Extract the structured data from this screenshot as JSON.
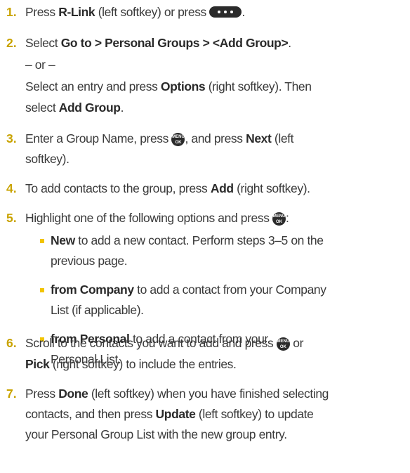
{
  "steps": [
    {
      "num": "1.",
      "parts": [
        {
          "t": "Press "
        },
        {
          "b": "R-Link"
        },
        {
          "t": " (left softkey) or press "
        },
        {
          "icon": "softkey-dots-icon"
        },
        {
          "t": "."
        }
      ]
    },
    {
      "num": "2.",
      "lines": [
        [
          {
            "t": "Select "
          },
          {
            "b": "Go to > Personal Groups > <Add Group>"
          },
          {
            "t": "."
          }
        ],
        [
          {
            "t": "– or –"
          }
        ],
        [
          {
            "t": "Select an entry and press "
          },
          {
            "b": "Options"
          },
          {
            "t": " (right softkey). Then"
          }
        ],
        [
          {
            "t": "select "
          },
          {
            "b": "Add Group"
          },
          {
            "t": "."
          }
        ]
      ]
    },
    {
      "num": "3.",
      "lines": [
        [
          {
            "t": "Enter a Group Name, press "
          },
          {
            "icon": "menu-ok-icon"
          },
          {
            "t": ", and press "
          },
          {
            "b": "Next"
          },
          {
            "t": " (left"
          }
        ],
        [
          {
            "t": "softkey)."
          }
        ]
      ]
    },
    {
      "num": "4.",
      "lines": [
        [
          {
            "t": "To add contacts to the group, press "
          },
          {
            "b": "Add"
          },
          {
            "t": " (right softkey)."
          }
        ]
      ]
    },
    {
      "num": "5.",
      "lines": [
        [
          {
            "t": "Highlight one of the following options and press "
          },
          {
            "icon": "menu-ok-icon"
          },
          {
            "t": ":"
          }
        ]
      ],
      "bullets": [
        [
          [
            {
              "b": "New"
            },
            {
              "t": " to add a new contact. Perform steps 3–5 on the"
            }
          ],
          [
            {
              "t": "previous page."
            }
          ]
        ],
        [
          [
            {
              "b": "from Company"
            },
            {
              "t": " to add a contact from your Company"
            }
          ],
          [
            {
              "t": "List (if applicable)."
            }
          ]
        ],
        [
          [
            {
              "b": "from Personal"
            },
            {
              "t": " to add a contact from your"
            }
          ],
          [
            {
              "t": "Personal List."
            }
          ]
        ]
      ]
    },
    {
      "num": "6.",
      "lines": [
        [
          {
            "t": "Scroll to the contacts you want to add and press "
          },
          {
            "icon": "menu-ok-icon"
          },
          {
            "t": " or"
          }
        ],
        [
          {
            "b": "Pick"
          },
          {
            "t": " (right softkey) to include the entries."
          }
        ]
      ]
    },
    {
      "num": "7.",
      "lines": [
        [
          {
            "t": "Press "
          },
          {
            "b": "Done"
          },
          {
            "t": " (left softkey) when you have finished selecting"
          }
        ],
        [
          {
            "t": "contacts, and then press "
          },
          {
            "b": "Update"
          },
          {
            "t": " (left softkey) to update"
          }
        ],
        [
          {
            "t": "your Personal Group List with the new group entry."
          }
        ]
      ]
    }
  ],
  "icons": {
    "menu_ok_top": "MENU",
    "menu_ok_bottom": "OK"
  },
  "colors": {
    "number": "#c9a300",
    "bullet": "#f2c400",
    "text": "#3a3a3a"
  }
}
